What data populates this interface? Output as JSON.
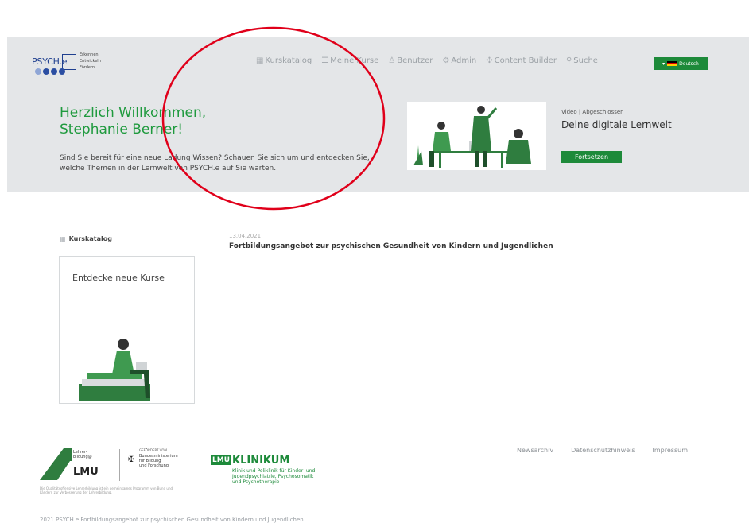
{
  "brand": {
    "name": "PSYCH.e",
    "tagline_lines": [
      "Erkennen",
      "Entwickeln",
      "Fördern"
    ]
  },
  "nav": {
    "items": [
      {
        "label": "Kurskatalog",
        "icon": "grid-icon"
      },
      {
        "label": "Meine Kurse",
        "icon": "list-icon"
      },
      {
        "label": "Benutzer",
        "icon": "user-icon"
      },
      {
        "label": "Admin",
        "icon": "settings-icon"
      },
      {
        "label": "Content Builder",
        "icon": "puzzle-icon"
      },
      {
        "label": "Suche",
        "icon": "search-icon"
      }
    ],
    "language": "Deutsch"
  },
  "hero": {
    "title_line1": "Herzlich Willkommen,",
    "title_line2": "Stephanie Berner!",
    "text": "Sind Sie bereit für eine neue Ladung Wissen? Schauen Sie sich um und entdecken Sie, welche Themen in der Lernwelt von PSYCH.e auf Sie warten."
  },
  "video": {
    "meta": "Video | Abgeschlossen",
    "title": "Deine digitale Lernwelt",
    "button": "Fortsetzen"
  },
  "catalog": {
    "label": "Kurskatalog",
    "card_title": "Entdecke neue Kurse"
  },
  "news": {
    "date": "13.04.2021",
    "title": "Fortbildungsangebot zur psychischen Gesundheit von Kindern und Jugendlichen"
  },
  "footer": {
    "links": [
      "Newsarchiv",
      "Datenschutzhinweis",
      "Impressum"
    ],
    "lmu_small": [
      "Lehrer-",
      "bildung@"
    ],
    "lmu": "LMU",
    "bmbf_top": "GEFÖRDERT VOM",
    "bmbf_lines": [
      "Bundesministerium",
      "für Bildung",
      "und Forschung"
    ],
    "small_print": "Die Qualitätsoffensive Lehrerbildung ist ein gemeinsames Programm von Bund und Ländern zur Verbesserung der Lehrerbildung.",
    "klinikum_box": "LMU",
    "klinikum_title": "KLINIKUM",
    "klinikum_sub": [
      "Klinik und Poliklinik für Kinder- und",
      "Jugendpsychiatrie, Psychosomatik",
      "und Psychotherapie"
    ],
    "copyright": "2021 PSYCH.e Fortbildungsangebot zur psychischen Gesundheit von Kindern und Jugendlichen"
  },
  "colors": {
    "accent_green": "#1d8a3a",
    "header_band": "#e4e6e8",
    "annotation_red": "#e0001a"
  }
}
